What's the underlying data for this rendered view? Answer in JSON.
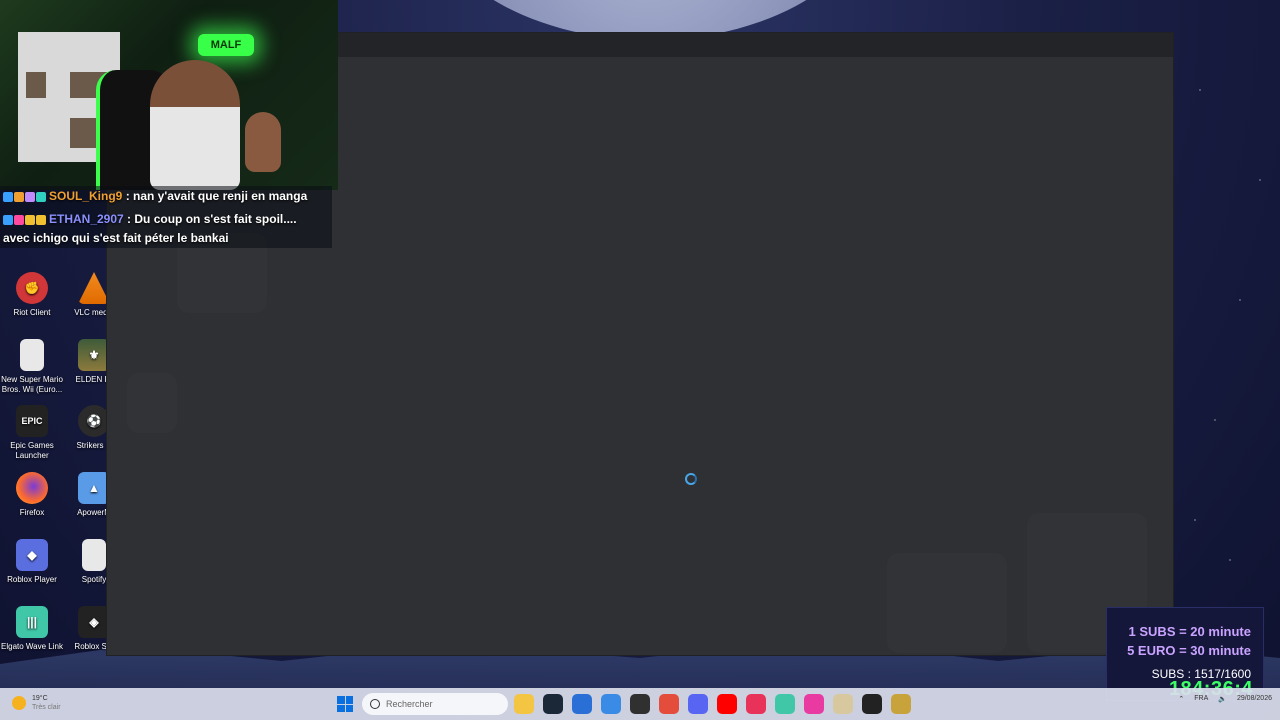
{
  "desktop_icons": [
    {
      "label": "Riot Client",
      "glyph": "✊"
    },
    {
      "label": "VLC media",
      "glyph": ""
    },
    {
      "label": "New Super Mario Bros. Wii (Euro...",
      "glyph": ""
    },
    {
      "label": "ELDEN RI",
      "glyph": "⚜"
    },
    {
      "label": "Epic Games Launcher",
      "glyph": "EPIC"
    },
    {
      "label": "Strikers C",
      "glyph": "⚽"
    },
    {
      "label": "Firefox",
      "glyph": ""
    },
    {
      "label": "ApowerM",
      "glyph": "▲"
    },
    {
      "label": "Roblox Player",
      "glyph": "◆"
    },
    {
      "label": "Spotify",
      "glyph": ""
    },
    {
      "label": "Elgato Wave Link",
      "glyph": "|||"
    },
    {
      "label": "Roblox Stu",
      "glyph": "◈"
    }
  ],
  "webcam": {
    "neon_sign": "MALF"
  },
  "chat": [
    {
      "user": "SOUL_King9",
      "message": ": nan y'avait que renji en manga"
    },
    {
      "user": "ETHAN_2907",
      "message": ": Du coup on s'est fait spoil...."
    },
    {
      "user": "",
      "message": "avec ichigo qui s'est fait péter le bankai"
    }
  ],
  "subathon": {
    "line1": "1 SUBS = 20 minute",
    "line2": "5 EURO = 30 minute",
    "subs": "SUBS : 1517/1600",
    "timer": "184:36:4"
  },
  "taskbar": {
    "weather_temp": "19°C",
    "weather_desc": "Très clair",
    "search_placeholder": "Rechercher",
    "language": "FRA",
    "date": "29/08/2026",
    "apps": [
      {
        "name": "file-explorer-icon",
        "color": "#f4c542"
      },
      {
        "name": "steam-icon",
        "color": "#1b2838"
      },
      {
        "name": "microsoft-store-icon",
        "color": "#2a6fd6"
      },
      {
        "name": "battlenet-icon",
        "color": "#3a8be6"
      },
      {
        "name": "obs-icon",
        "color": "#303030"
      },
      {
        "name": "chrome-icon",
        "color": "#e44c3c"
      },
      {
        "name": "discord-icon",
        "color": "#5865f2"
      },
      {
        "name": "youtube-icon",
        "color": "#ff0000"
      },
      {
        "name": "tiktok-icon",
        "color": "#e8325a"
      },
      {
        "name": "wave-link-icon",
        "color": "#3fc7a8"
      },
      {
        "name": "camera-app-icon",
        "color": "#e83aa0"
      },
      {
        "name": "launcher-icon",
        "color": "#d8c8a0"
      },
      {
        "name": "epic-icon",
        "color": "#222222"
      },
      {
        "name": "lol-icon",
        "color": "#c8a23a"
      }
    ]
  }
}
